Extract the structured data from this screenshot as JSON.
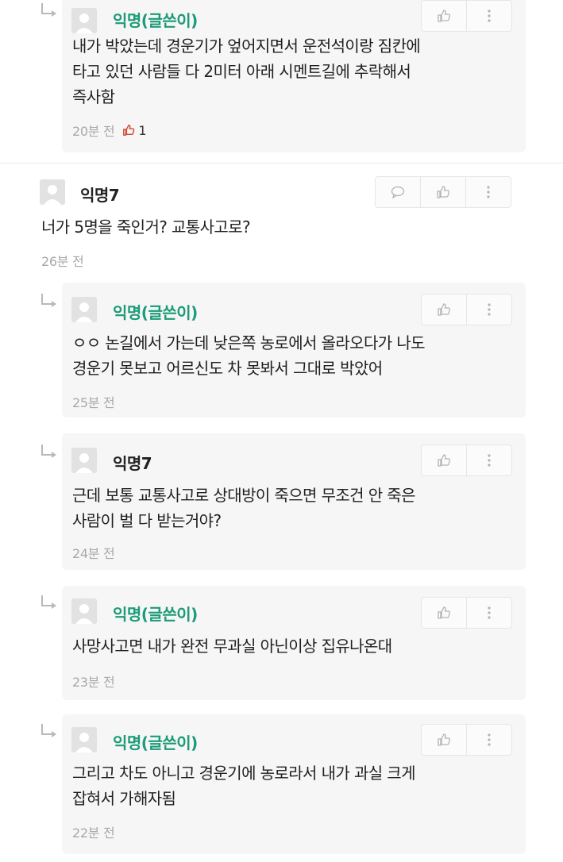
{
  "comments": [
    {
      "author": "익명(글쓴이)",
      "text": "내가 박았는데 경운기가 엎어지면서 운전석이랑 짐칸에\n타고 있던 사람들 다 2미터 아래 시멘트길에 추락해서\n즉사함",
      "time": "20분 전",
      "likes": "1"
    },
    {
      "author": "익명7",
      "text": "너가 5명을 죽인거? 교통사고로?",
      "time": "26분 전"
    },
    {
      "author": "익명(글쓴이)",
      "text": "ㅇㅇ 논길에서 가는데 낮은쪽 농로에서 올라오다가 나도\n경운기 못보고 어르신도 차 못봐서 그대로 박았어",
      "time": "25분 전"
    },
    {
      "author": "익명7",
      "text": "근데 보통 교통사고로 상대방이 죽으면 무조건 안 죽은\n사람이 벌 다 받는거야?",
      "time": "24분 전"
    },
    {
      "author": "익명(글쓴이)",
      "text": "사망사고면 내가 완전 무과실 아닌이상 집유나온대",
      "time": "23분 전"
    },
    {
      "author": "익명(글쓴이)",
      "text": "그리고 차도 아니고 경운기에 농로라서 내가 과실 크게\n잡혀서 가해자됨",
      "time": "22분 전"
    }
  ],
  "icons": {
    "reply": "speech-bubble-icon",
    "like": "thumbs-up-icon",
    "more": "vertical-dots-icon"
  },
  "colors": {
    "author_name": "#1b9b77",
    "meta_text": "#a8a8a8",
    "reply_bg": "#f6f6f6"
  }
}
